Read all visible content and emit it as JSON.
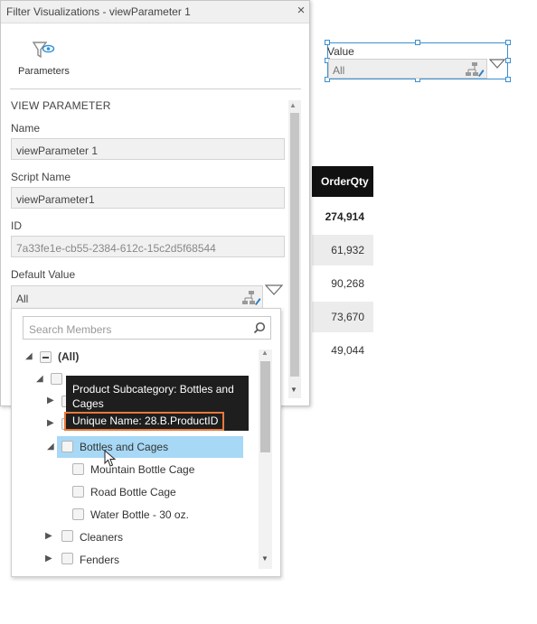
{
  "dialog": {
    "title": "Filter Visualizations - viewParameter 1",
    "close_glyph": "×",
    "toolbar": {
      "parameters_label": "Parameters",
      "parameters_icon": "filter-eye-icon"
    },
    "section_heading": "VIEW PARAMETER",
    "fields": {
      "name": {
        "label": "Name",
        "value": "viewParameter 1"
      },
      "script_name": {
        "label": "Script Name",
        "value": "viewParameter1"
      },
      "id": {
        "label": "ID",
        "value": "7a33fe1e-cb55-2384-612c-15c2d5f68544"
      },
      "default_value": {
        "label": "Default Value",
        "value": "All"
      }
    }
  },
  "member_dropdown": {
    "search_placeholder": "Search Members",
    "tree": {
      "all": "(All)",
      "bottles_and_cages": "Bottles and Cages",
      "mountain_bottle_cage": "Mountain Bottle Cage",
      "road_bottle_cage": "Road Bottle Cage",
      "water_bottle": "Water Bottle - 30 oz.",
      "cleaners": "Cleaners",
      "fenders": "Fenders"
    },
    "tooltip": {
      "caption": "Product Subcategory: Bottles and Cages",
      "unique_name": "Unique Name: 28.B.ProductID"
    }
  },
  "value_widget": {
    "label": "Value",
    "value": "All"
  },
  "table": {
    "header": "OrderQty",
    "rows": [
      "274,914",
      "61,932",
      "90,268",
      "73,670",
      "49,044"
    ]
  },
  "colors": {
    "accent_blue": "#3b8fd0",
    "selection": "#a7d8f5",
    "tooltip_bg": "#1e1e1e",
    "highlight_border": "#e8793a"
  }
}
